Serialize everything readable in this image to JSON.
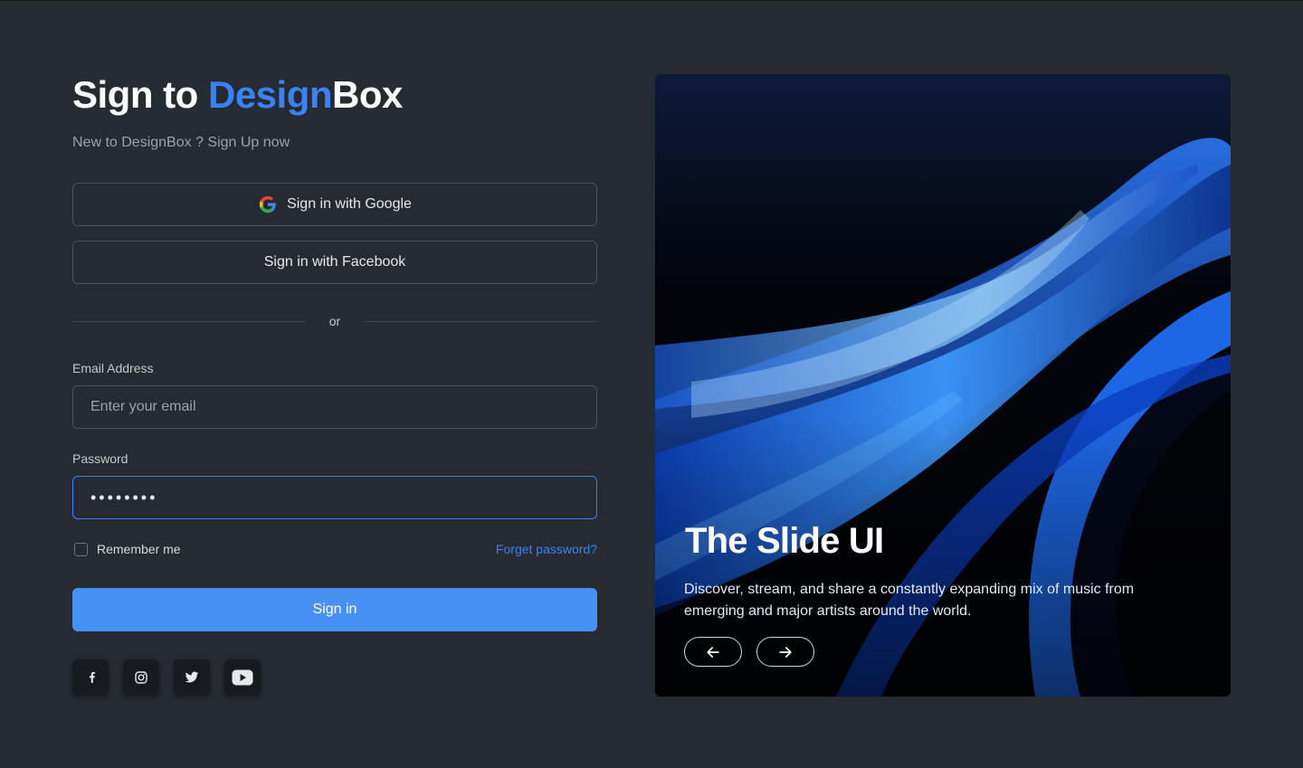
{
  "header": {
    "title_prefix": "Sign to ",
    "title_accent": "Design",
    "title_suffix": "Box",
    "subtitle": "New to DesignBox ? Sign Up now"
  },
  "oauth": {
    "google_label": "Sign in with Google",
    "facebook_label": "Sign in with Facebook"
  },
  "divider": {
    "text": "or"
  },
  "form": {
    "email_label": "Email Address",
    "email_placeholder": "Enter your email",
    "email_value": "",
    "password_label": "Password",
    "password_value": "password",
    "remember_label": "Remember me",
    "remember_checked": false,
    "forgot_label": "Forget password?",
    "submit_label": "Sign in"
  },
  "socials": [
    {
      "icon": "facebook-icon"
    },
    {
      "icon": "instagram-icon"
    },
    {
      "icon": "twitter-icon"
    },
    {
      "icon": "youtube-icon"
    }
  ],
  "hero": {
    "title": "The Slide UI",
    "description": "Discover, stream, and share a constantly expanding mix of music from emerging and major artists around the world.",
    "prev_icon": "arrow-left-icon",
    "next_icon": "arrow-right-icon"
  },
  "colors": {
    "background": "#252b31",
    "accent": "#3b82f6",
    "primary_button": "#4791f5",
    "border": "#4a525b"
  }
}
